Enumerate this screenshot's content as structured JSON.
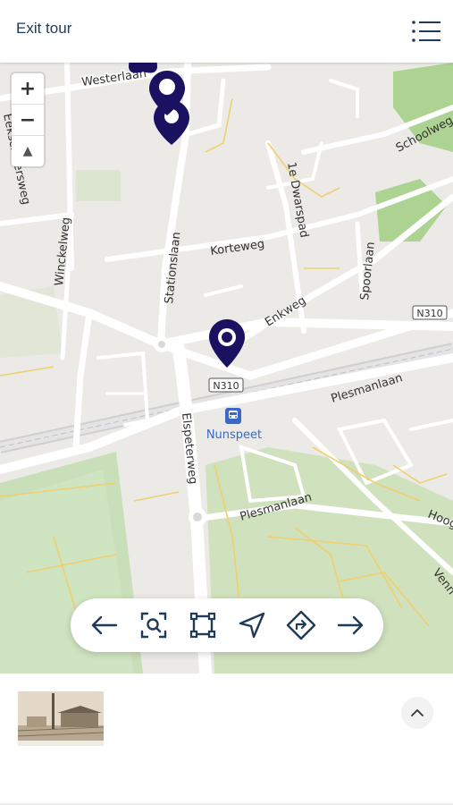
{
  "header": {
    "exit_label": "Exit tour",
    "menu_icon": "hamburger-menu-icon"
  },
  "map": {
    "zoom_in": "+",
    "zoom_out": "−",
    "compass": "▲",
    "street_labels": {
      "westerlaan": "Westerlaan",
      "eekschillersweg": "Eekschillersweg",
      "winckelweg": "Winckelweg",
      "stationslaan": "Stationslaan",
      "korteweg": "Korteweg",
      "dwarspad": "1e Dwarspad",
      "enkweg": "Enkweg",
      "spoorlaan": "Spoorlaan",
      "schoolweg": "Schoolweg",
      "n310_a": "N310",
      "n310_b": "N310",
      "plesmanlaan_a": "Plesmanlaan",
      "plesmanlaan_b": "Plesmanlaan",
      "elspeterweg": "Elspeterweg",
      "station": "Nunspeet",
      "hoog": "Hoog",
      "venn": "Venn"
    },
    "colors": {
      "pin": "#1a1160",
      "water_green": "#c9dfbb",
      "park": "#a9d58f",
      "road": "#ffffff",
      "minor_road": "#f2d37a"
    }
  },
  "toolbar": {
    "items": [
      {
        "icon": "arrow-left-icon"
      },
      {
        "icon": "zoom-search-icon"
      },
      {
        "icon": "fit-bounds-icon"
      },
      {
        "icon": "navigate-icon"
      },
      {
        "icon": "directions-icon"
      },
      {
        "icon": "arrow-right-icon"
      }
    ]
  },
  "panel": {
    "thumbnail_icon": "station-photo-thumbnail",
    "collapse_icon": "chevron-up-icon"
  }
}
